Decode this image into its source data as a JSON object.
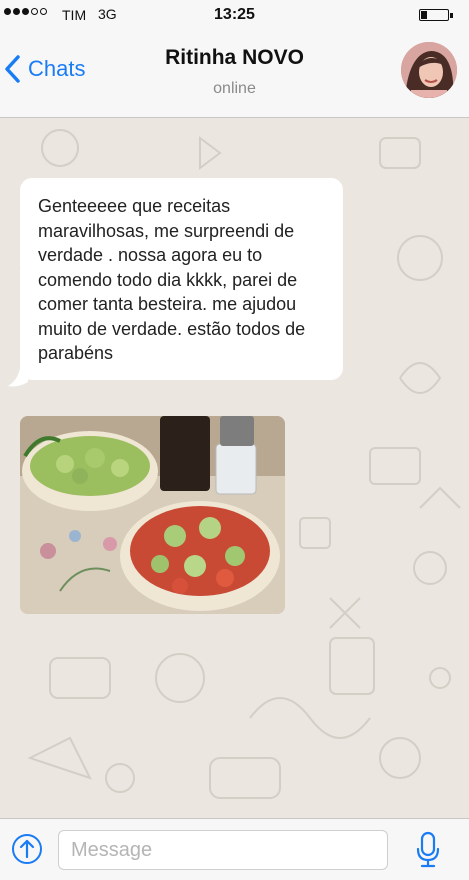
{
  "status_bar": {
    "carrier": "TIM",
    "network": "3G",
    "time": "13:25",
    "signal_bars_filled": 3,
    "signal_bars_total": 5
  },
  "header": {
    "back_label": "Chats",
    "contact_name": "Ritinha NOVO",
    "contact_status": "online",
    "accent_color": "#1a7cf5"
  },
  "messages": [
    {
      "type": "text",
      "direction": "incoming",
      "text": "Genteeeee que receitas maravilhosas, me surpreendi de verdade . nossa agora eu to comendo todo dia kkkk, parei de comer tanta besteira. me ajudou muito de verdade. estão todos de parabéns"
    },
    {
      "type": "image",
      "direction": "incoming"
    }
  ],
  "input_bar": {
    "placeholder": "Message"
  },
  "icons": {
    "back": "chevron-left-icon",
    "upload": "upload-circle-icon",
    "mic": "microphone-icon"
  }
}
